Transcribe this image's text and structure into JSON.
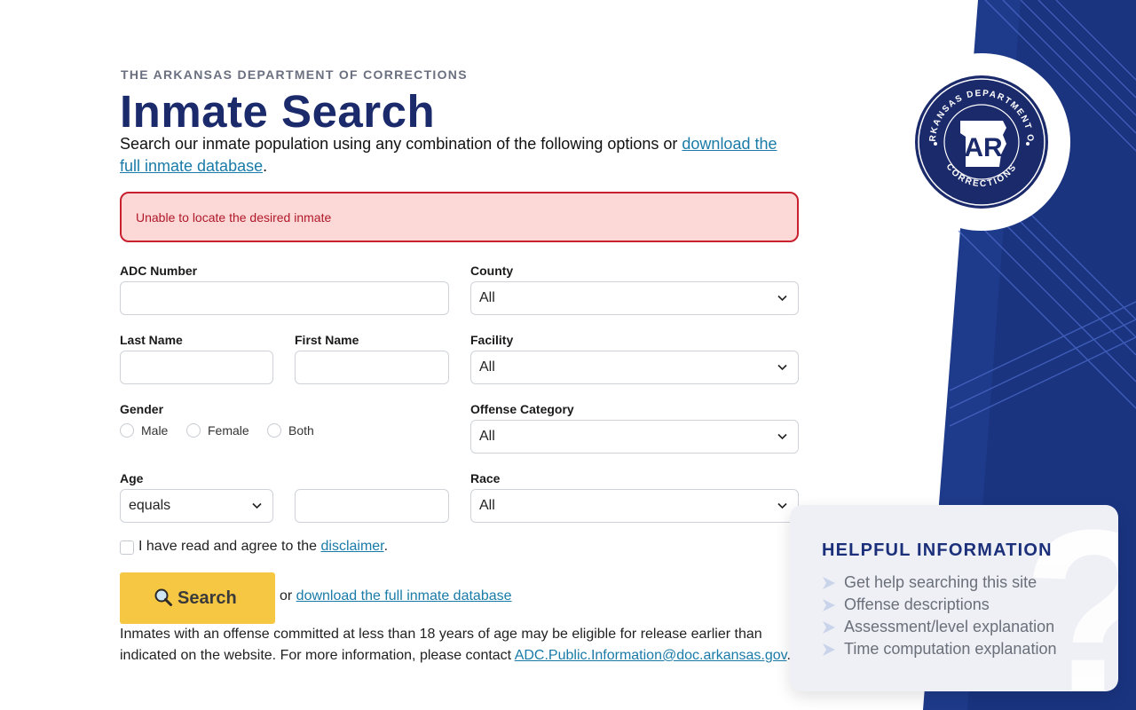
{
  "header": {
    "eyebrow": "THE ARKANSAS DEPARTMENT OF CORRECTIONS",
    "title": "Inmate Search",
    "intro_text": "Search our inmate population using any combination of the following options or ",
    "intro_link": "download the full inmate database",
    "intro_end": "."
  },
  "seal": {
    "top_text": "ARKANSAS DEPARTMENT OF",
    "bottom_text": "CORRECTIONS",
    "center_text": "AR"
  },
  "alert": {
    "message": "Unable to locate the desired inmate"
  },
  "form": {
    "adc_number_label": "ADC Number",
    "county_label": "County",
    "county_value": "All",
    "last_name_label": "Last Name",
    "first_name_label": "First Name",
    "facility_label": "Facility",
    "facility_value": "All",
    "gender_label": "Gender",
    "gender_options": [
      "Male",
      "Female",
      "Both"
    ],
    "offense_category_label": "Offense Category",
    "offense_category_value": "All",
    "age_label": "Age",
    "age_operator_value": "equals",
    "race_label": "Race",
    "race_value": "All",
    "agree_text": "I have read and agree to the ",
    "disclaimer_link": "disclaimer",
    "agree_end": "."
  },
  "actions": {
    "search_label": "Search",
    "or_text": "or ",
    "download_link": "download the full inmate database"
  },
  "notice": {
    "text": "Inmates with an offense committed at less than 18 years of age may be eligible for release earlier than indicated on the website. For more information, please contact ",
    "email_link": "ADC.Public.Information@doc.arkansas.gov",
    "end": "."
  },
  "help": {
    "title": "HELPFUL INFORMATION",
    "items": [
      "Get help searching this site",
      "Offense descriptions",
      "Assessment/level explanation",
      "Time computation explanation"
    ]
  },
  "colors": {
    "navy": "#1b2a6b",
    "accent_yellow": "#f6c742",
    "alert_bg": "#fcd9d6",
    "alert_border": "#c8202e",
    "link": "#1a7ba8"
  }
}
